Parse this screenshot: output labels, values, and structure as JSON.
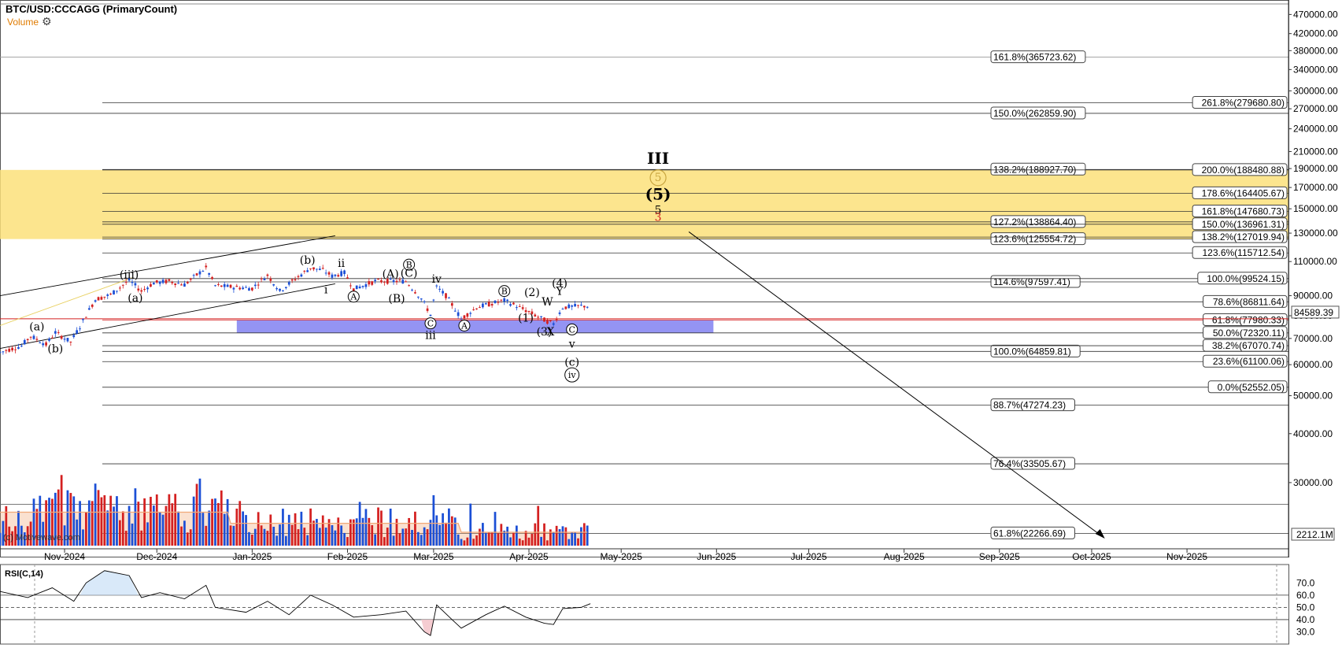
{
  "header": {
    "symbol": "BTC/USD:CCCAGG (PrimaryCount)",
    "volume_label": "Volume",
    "settings_icon": "gear-icon"
  },
  "watermark": "(c) Motivewave.com",
  "rsi_label": "RSI(C,14)",
  "colors": {
    "golden_zone": "#fbe17a",
    "support_zone": "#8888f2",
    "up": "#1b4fd6",
    "down": "#d42020",
    "price_line": "#d42020",
    "volume_avg": "#f0a878"
  },
  "chart_data": {
    "type": "candlestick",
    "y_scale": "log",
    "y_range": [
      21000,
      500000
    ],
    "y_ticks": [
      "470000.00",
      "420000.00",
      "380000.00",
      "340000.00",
      "300000.00",
      "270000.00",
      "240000.00",
      "210000.00",
      "190000.00",
      "170000.00",
      "150000.00",
      "130000.00",
      "110000.00",
      "90000.00",
      "80000.00",
      "70000.00",
      "60000.00",
      "50000.00",
      "40000.00",
      "30000.00"
    ],
    "x_ticks": [
      "Nov-2024",
      "Dec-2024",
      "Jan-2025",
      "Feb-2025",
      "Mar-2025",
      "Apr-2025",
      "May-2025",
      "Jun-2025",
      "Jul-2025",
      "Aug-2025",
      "Sep-2025",
      "Oct-2025",
      "Nov-2025"
    ],
    "x_tick_dates": [
      "2024-11-01",
      "2024-12-01",
      "2025-01-01",
      "2025-02-01",
      "2025-03-01",
      "2025-04-01",
      "2025-05-01",
      "2025-06-01",
      "2025-07-01",
      "2025-08-01",
      "2025-09-01",
      "2025-10-01",
      "2025-11-01"
    ],
    "x_range": [
      "2024-10-11",
      "2025-12-04"
    ],
    "last_price": "84589.39",
    "last_volume": "2212.1M",
    "price_path": [
      {
        "date": "2024-10-11",
        "price": 64500
      },
      {
        "date": "2024-10-18",
        "price": 67000
      },
      {
        "date": "2024-10-21",
        "price": 71000
      },
      {
        "date": "2024-10-26",
        "price": 67500
      },
      {
        "date": "2024-10-29",
        "price": 72500
      },
      {
        "date": "2024-11-03",
        "price": 68500
      },
      {
        "date": "2024-11-06",
        "price": 75000
      },
      {
        "date": "2024-11-11",
        "price": 88000
      },
      {
        "date": "2024-11-16",
        "price": 90500
      },
      {
        "date": "2024-11-22",
        "price": 98500
      },
      {
        "date": "2024-11-26",
        "price": 92500
      },
      {
        "date": "2024-11-30",
        "price": 97000
      },
      {
        "date": "2024-12-05",
        "price": 98000
      },
      {
        "date": "2024-12-10",
        "price": 96000
      },
      {
        "date": "2024-12-17",
        "price": 106000
      },
      {
        "date": "2024-12-20",
        "price": 95500
      },
      {
        "date": "2024-12-27",
        "price": 94500
      },
      {
        "date": "2025-01-01",
        "price": 94000
      },
      {
        "date": "2025-01-06",
        "price": 101500
      },
      {
        "date": "2025-01-10",
        "price": 92500
      },
      {
        "date": "2025-01-20",
        "price": 106000
      },
      {
        "date": "2025-01-24",
        "price": 104500
      },
      {
        "date": "2025-01-27",
        "price": 101000
      },
      {
        "date": "2025-01-31",
        "price": 103000
      },
      {
        "date": "2025-02-03",
        "price": 93500
      },
      {
        "date": "2025-02-10",
        "price": 98000
      },
      {
        "date": "2025-02-20",
        "price": 98000
      },
      {
        "date": "2025-02-25",
        "price": 88500
      },
      {
        "date": "2025-02-28",
        "price": 80500
      },
      {
        "date": "2025-03-02",
        "price": 94500
      },
      {
        "date": "2025-03-05",
        "price": 90000
      },
      {
        "date": "2025-03-10",
        "price": 78500
      },
      {
        "date": "2025-03-15",
        "price": 84000
      },
      {
        "date": "2025-03-24",
        "price": 87500
      },
      {
        "date": "2025-03-31",
        "price": 82500
      },
      {
        "date": "2025-04-06",
        "price": 78000
      },
      {
        "date": "2025-04-09",
        "price": 76300
      },
      {
        "date": "2025-04-12",
        "price": 84000
      },
      {
        "date": "2025-04-18",
        "price": 84800
      },
      {
        "date": "2025-04-21",
        "price": 84589
      }
    ],
    "fib_left": [
      {
        "pct": "161.8%",
        "value": "365723.62"
      },
      {
        "pct": "150.0%",
        "value": "262859.90"
      },
      {
        "pct": "138.2%",
        "value": "188927.70"
      },
      {
        "pct": "127.2%",
        "value": "138864.40"
      },
      {
        "pct": "123.6%",
        "value": "125554.72"
      },
      {
        "pct": "114.6%",
        "value": "97597.41"
      },
      {
        "pct": "100.0%",
        "value": "64859.81"
      },
      {
        "pct": "88.7%",
        "value": "47274.23"
      },
      {
        "pct": "76.4%",
        "value": "33505.67"
      },
      {
        "pct": "61.8%",
        "value": "22266.69"
      }
    ],
    "fib_right": [
      {
        "pct": "261.8%",
        "value": "279680.80"
      },
      {
        "pct": "200.0%",
        "value": "188480.88"
      },
      {
        "pct": "178.6%",
        "value": "164405.67"
      },
      {
        "pct": "161.8%",
        "value": "147680.73"
      },
      {
        "pct": "150.0%",
        "value": "136961.31"
      },
      {
        "pct": "138.2%",
        "value": "127019.94"
      },
      {
        "pct": "123.6%",
        "value": "115712.54"
      },
      {
        "pct": "100.0%",
        "value": "99524.15"
      },
      {
        "pct": "78.6%",
        "value": "86811.64"
      },
      {
        "pct": "61.8%",
        "value": "77980.33"
      },
      {
        "pct": "50.0%",
        "value": "72320.11"
      },
      {
        "pct": "38.2%",
        "value": "67070.74"
      },
      {
        "pct": "23.6%",
        "value": "61100.06"
      },
      {
        "pct": "0.0%",
        "value": "52552.05"
      }
    ],
    "zones": [
      {
        "name": "golden",
        "from": 125554.72,
        "to": 188480.88
      },
      {
        "name": "support",
        "from": 72320.11,
        "to": 77980.33,
        "start": "2024-12-27",
        "end": "2025-05-31"
      }
    ],
    "wave_labels": [
      {
        "text": "III",
        "date": "2025-05-13",
        "price": 200000
      },
      {
        "text": "5",
        "date": "2025-05-13",
        "price": 180000,
        "circled": true
      },
      {
        "text": "(5)",
        "date": "2025-05-13",
        "price": 162000
      },
      {
        "text": "5",
        "date": "2025-05-13",
        "price": 149000
      },
      {
        "text": "3",
        "date": "2025-05-13",
        "price": 143000
      },
      {
        "text": "(iii)",
        "date": "2024-11-22",
        "price": 102000
      },
      {
        "text": "(a)",
        "date": "2024-11-24",
        "price": 89000
      },
      {
        "text": "(a)",
        "date": "2024-10-23",
        "price": 75200
      },
      {
        "text": "(b)",
        "date": "2024-10-29",
        "price": 66000
      },
      {
        "text": "(b)",
        "date": "2025-01-19",
        "price": 111000
      },
      {
        "text": "ii",
        "date": "2025-01-30",
        "price": 109000
      },
      {
        "text": "i",
        "date": "2025-01-25",
        "price": 93500
      },
      {
        "text": "A",
        "date": "2025-02-03",
        "price": 89500,
        "circled": true
      },
      {
        "text": "(A)",
        "date": "2025-02-15",
        "price": 102500
      },
      {
        "text": "B",
        "date": "2025-02-21",
        "price": 108000,
        "circled": true
      },
      {
        "text": "(C)",
        "date": "2025-02-21",
        "price": 103000
      },
      {
        "text": "(B)",
        "date": "2025-02-17",
        "price": 88500
      },
      {
        "text": "iv",
        "date": "2025-03-02",
        "price": 99500
      },
      {
        "text": "C",
        "date": "2025-02-28",
        "price": 76500,
        "circled": true
      },
      {
        "text": "iii",
        "date": "2025-02-28",
        "price": 71500
      },
      {
        "text": "A",
        "date": "2025-03-11",
        "price": 75500,
        "circled": true
      },
      {
        "text": "B",
        "date": "2025-03-24",
        "price": 92500,
        "circled": true
      },
      {
        "text": "(2)",
        "date": "2025-04-02",
        "price": 92000
      },
      {
        "text": "(1)",
        "date": "2025-03-31",
        "price": 79000
      },
      {
        "text": "W",
        "date": "2025-04-07",
        "price": 87000
      },
      {
        "text": "(4)",
        "date": "2025-04-11",
        "price": 97000
      },
      {
        "text": "Y",
        "date": "2025-04-11",
        "price": 92500
      },
      {
        "text": "(3)",
        "date": "2025-04-06",
        "price": 73000
      },
      {
        "text": "X",
        "date": "2025-04-08",
        "price": 72900
      },
      {
        "text": "C",
        "date": "2025-04-15",
        "price": 73800,
        "circled": true
      },
      {
        "text": "v",
        "date": "2025-04-15",
        "price": 67800
      },
      {
        "text": "(c)",
        "date": "2025-04-15",
        "price": 61000
      },
      {
        "text": "iv",
        "date": "2025-04-15",
        "price": 56500,
        "circled": true
      }
    ],
    "rsi": {
      "ticks": [
        "70.0",
        "60.0",
        "50.0",
        "40.0",
        "30.0"
      ],
      "range": [
        20,
        85
      ],
      "series": [
        {
          "date": "2024-10-11",
          "v": 63
        },
        {
          "date": "2024-10-20",
          "v": 58
        },
        {
          "date": "2024-10-28",
          "v": 66
        },
        {
          "date": "2024-11-04",
          "v": 55
        },
        {
          "date": "2024-11-08",
          "v": 70
        },
        {
          "date": "2024-11-14",
          "v": 80
        },
        {
          "date": "2024-11-22",
          "v": 76
        },
        {
          "date": "2024-11-26",
          "v": 58
        },
        {
          "date": "2024-12-02",
          "v": 62
        },
        {
          "date": "2024-12-10",
          "v": 57
        },
        {
          "date": "2024-12-17",
          "v": 68
        },
        {
          "date": "2024-12-20",
          "v": 50
        },
        {
          "date": "2024-12-30",
          "v": 46
        },
        {
          "date": "2025-01-06",
          "v": 55
        },
        {
          "date": "2025-01-13",
          "v": 44
        },
        {
          "date": "2025-01-20",
          "v": 60
        },
        {
          "date": "2025-01-27",
          "v": 52
        },
        {
          "date": "2025-02-03",
          "v": 42
        },
        {
          "date": "2025-02-12",
          "v": 44
        },
        {
          "date": "2025-02-20",
          "v": 47
        },
        {
          "date": "2025-02-26",
          "v": 30
        },
        {
          "date": "2025-02-28",
          "v": 27
        },
        {
          "date": "2025-03-02",
          "v": 52
        },
        {
          "date": "2025-03-07",
          "v": 40
        },
        {
          "date": "2025-03-10",
          "v": 33
        },
        {
          "date": "2025-03-18",
          "v": 44
        },
        {
          "date": "2025-03-24",
          "v": 51
        },
        {
          "date": "2025-03-31",
          "v": 42
        },
        {
          "date": "2025-04-06",
          "v": 37
        },
        {
          "date": "2025-04-09",
          "v": 36
        },
        {
          "date": "2025-04-12",
          "v": 49
        },
        {
          "date": "2025-04-18",
          "v": 50
        },
        {
          "date": "2025-04-21",
          "v": 53
        }
      ]
    }
  }
}
